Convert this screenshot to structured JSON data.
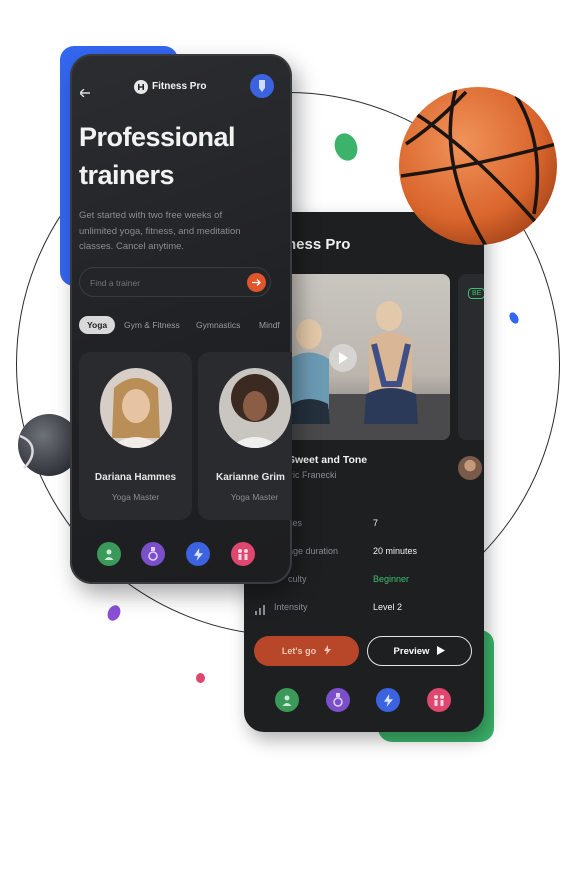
{
  "colors": {
    "accent_orange": "#e0552b",
    "brand_blue": "#3466f0",
    "brand_green": "#3bb36a",
    "beginner_green": "#3dbf6c",
    "nav_green": "#3b9a5a",
    "nav_purple": "#7b4fc9",
    "nav_blue": "#3b63e0",
    "nav_pink": "#e0476f"
  },
  "front": {
    "brand": "Fitness Pro",
    "title_line1": "Professional",
    "title_line2": "trainers",
    "subtitle": "Get started with two free weeks of unlimited yoga, fitness, and meditation classes. Cancel anytime.",
    "search": {
      "placeholder": "Find a trainer"
    },
    "tabs": [
      {
        "label": "Yoga",
        "active": true
      },
      {
        "label": "Gym & Fitness"
      },
      {
        "label": "Gymnastics"
      },
      {
        "label": "Mindf"
      }
    ],
    "trainers": [
      {
        "name": "Dariana Hammes",
        "role": "Yoga Master"
      },
      {
        "name": "Karianne Grim",
        "role": "Yoga Master"
      }
    ],
    "nav": [
      "user-icon",
      "medal-icon",
      "bolt-icon",
      "pair-icon"
    ]
  },
  "back": {
    "brand": "tness Pro",
    "class_title": "Sweet and Tone",
    "instructor": "ric Franecki",
    "badge": "BE",
    "details": [
      {
        "label": "ses",
        "value": "7"
      },
      {
        "label": "age duration",
        "value": "20 minutes"
      },
      {
        "label": "culty",
        "value": "Beginner"
      },
      {
        "label": "Intensity",
        "value": "Level 2"
      }
    ],
    "go_button": "Let's go",
    "preview_button": "Preview",
    "nav": [
      "user-icon",
      "medal-icon",
      "bolt-icon",
      "pair-icon"
    ]
  }
}
